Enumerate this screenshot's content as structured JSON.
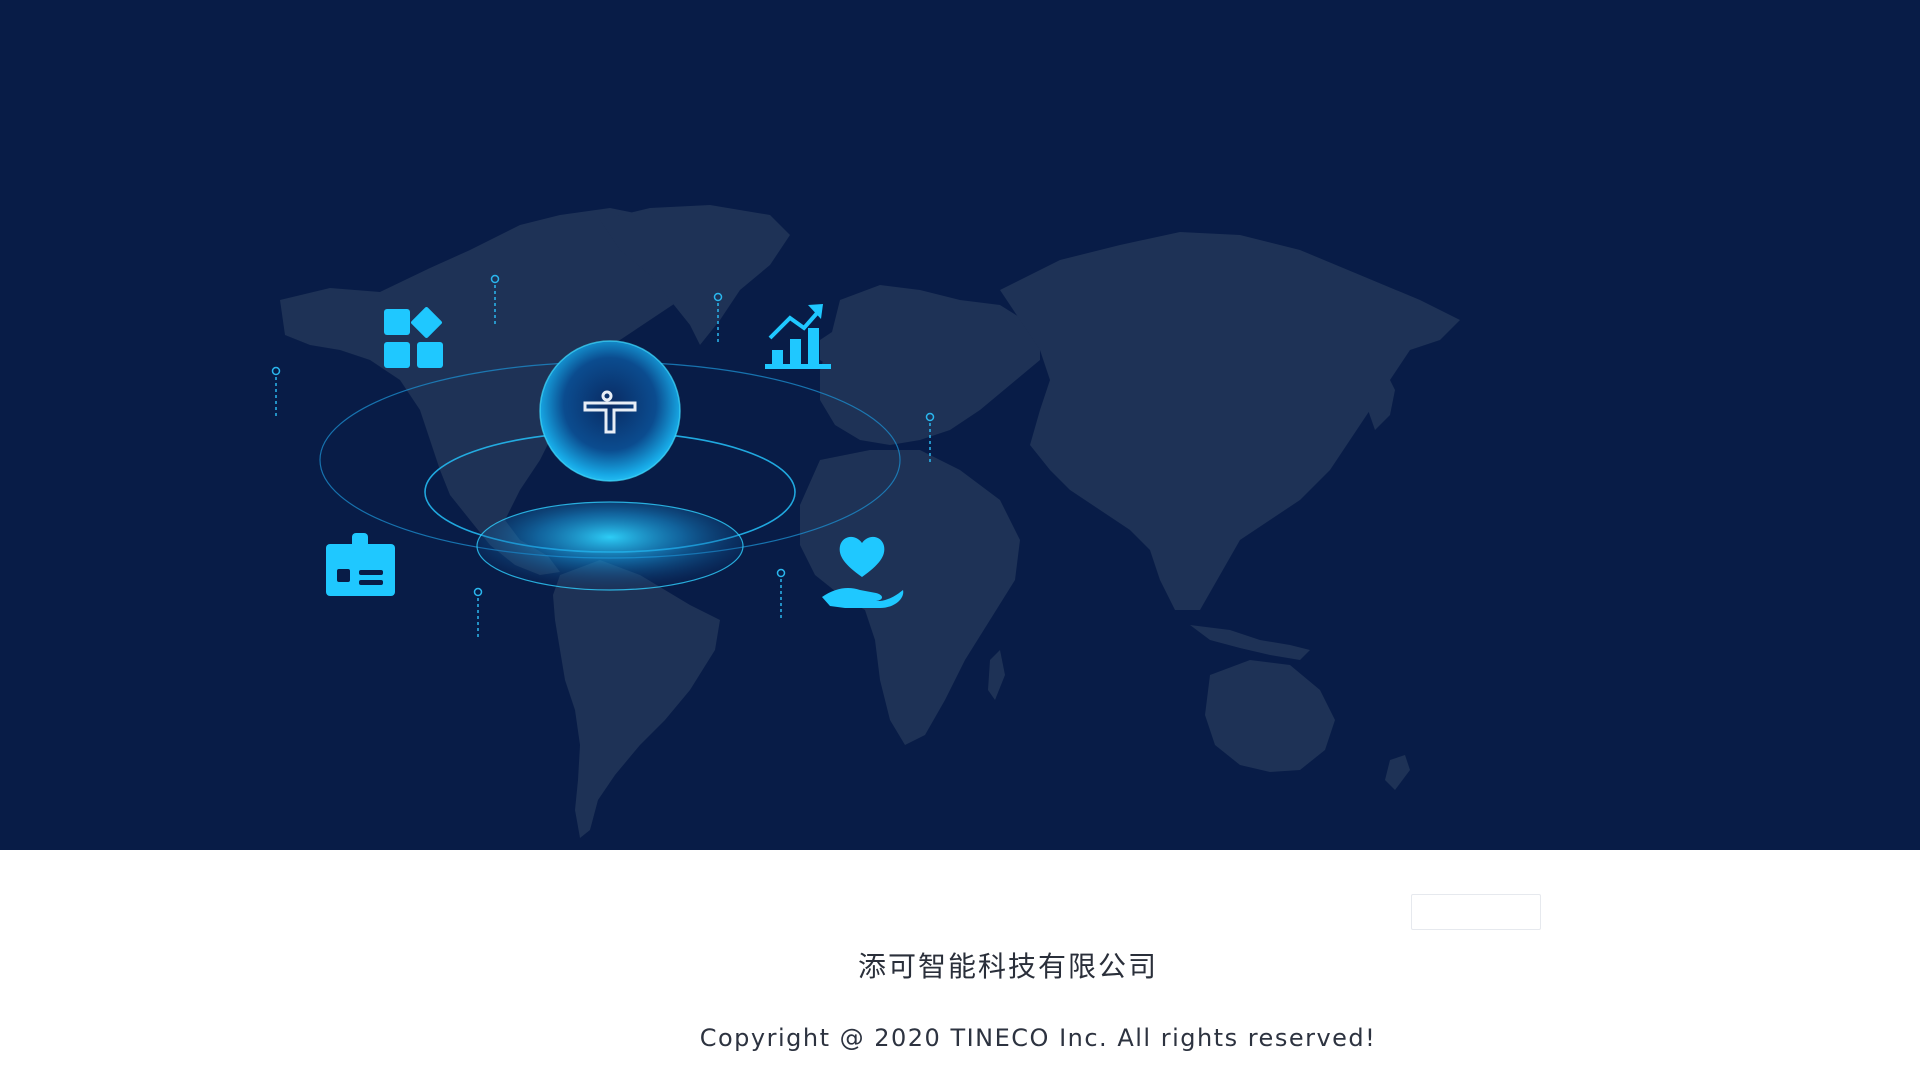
{
  "footer": {
    "company_name": "添可智能科技有限公司",
    "copyright": "Copyright @ 2020 TINECO Inc. All rights reserved!"
  },
  "hero": {
    "center_logo_letter": "T",
    "icons": [
      "apps-icon",
      "growth-chart-icon",
      "id-card-icon",
      "heart-hand-icon"
    ]
  },
  "colors": {
    "background": "#081c47",
    "continent": "#1e3256",
    "accent": "#1fc8ff",
    "text": "#2a2f3a"
  }
}
